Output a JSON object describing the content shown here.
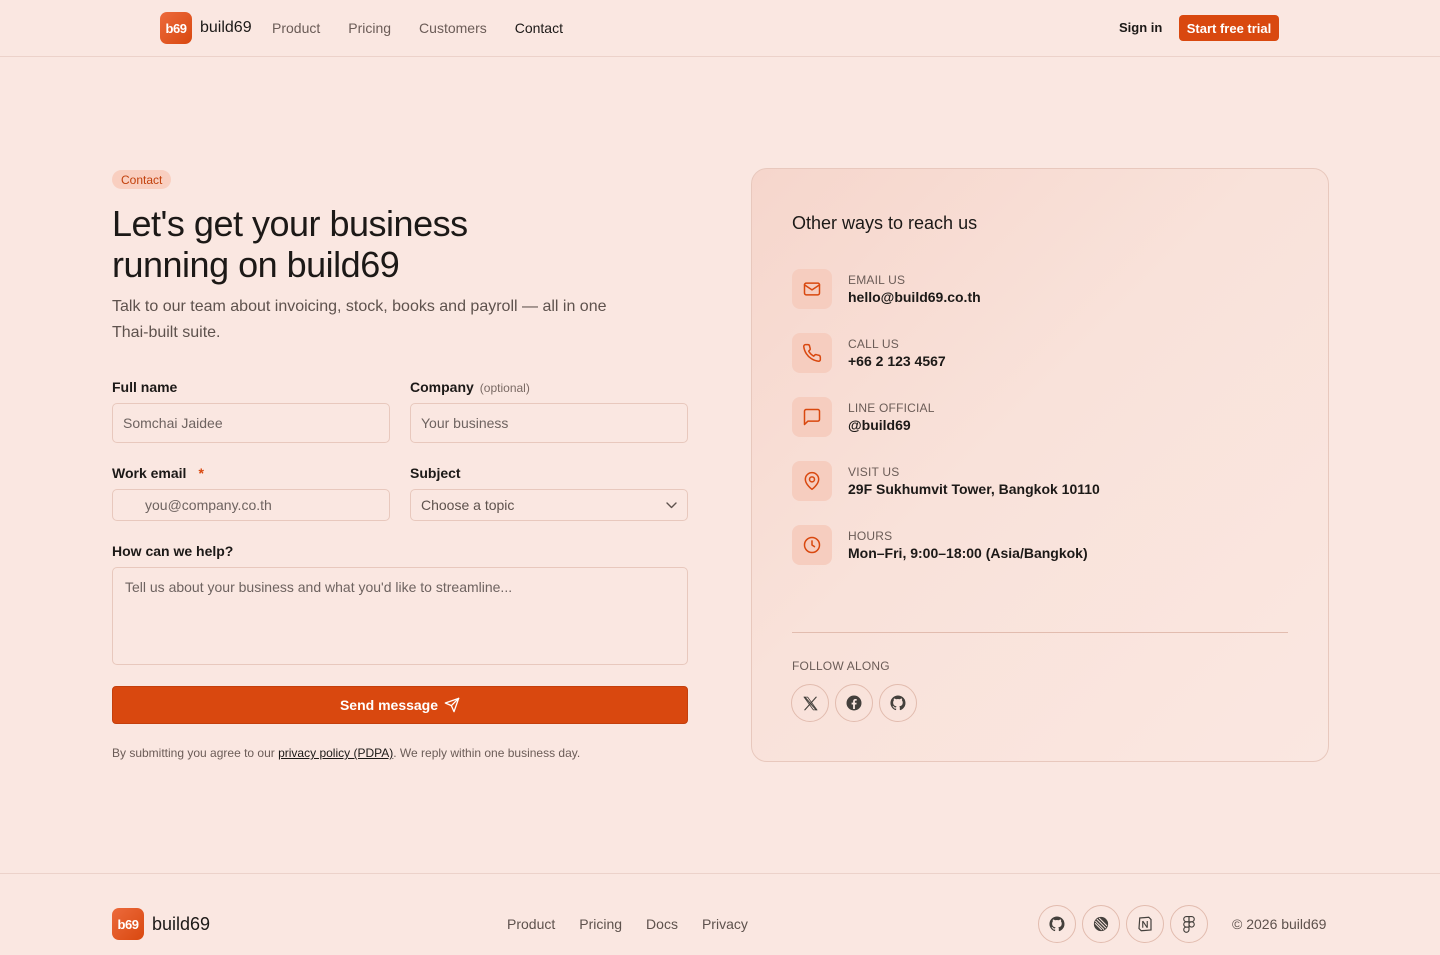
{
  "header": {
    "logo_text": "b69",
    "brand_name": "build69",
    "nav": [
      {
        "label": "Product"
      },
      {
        "label": "Pricing"
      },
      {
        "label": "Customers"
      },
      {
        "label": "Contact"
      }
    ],
    "sign_in": "Sign in",
    "cta": "Start free trial"
  },
  "intro": {
    "pill": "Contact",
    "title": "Let's get your business running on build69",
    "subtitle": "Talk to our team about invoicing, stock, books and payroll — all in one Thai-built suite."
  },
  "form": {
    "full_name": {
      "label": "Full name",
      "placeholder": "Somchai Jaidee"
    },
    "company": {
      "label": "Company",
      "optional": "(optional)",
      "placeholder": "Your business"
    },
    "email": {
      "label": "Work email",
      "required_mark": "*",
      "placeholder": "you@company.co.th"
    },
    "subject": {
      "label": "Subject",
      "value": "Choose a topic"
    },
    "message": {
      "label": "How can we help?",
      "placeholder": "Tell us about your business and what you'd like to streamline..."
    },
    "submit": "Send message",
    "disclaimer_before": "By submitting you agree to our ",
    "disclaimer_link": "privacy policy (PDPA)",
    "disclaimer_after": ". We reply within one business day."
  },
  "card": {
    "title": "Other ways to reach us",
    "items": [
      {
        "label": "EMAIL US",
        "value": "hello@build69.co.th",
        "icon": "mail-icon"
      },
      {
        "label": "CALL US",
        "value": "+66 2 123 4567",
        "icon": "phone-icon"
      },
      {
        "label": "LINE OFFICIAL",
        "value": "@build69",
        "icon": "chat-icon"
      },
      {
        "label": "VISIT US",
        "value": "29F Sukhumvit Tower, Bangkok 10110",
        "icon": "map-pin-icon"
      },
      {
        "label": "HOURS",
        "value": "Mon–Fri, 9:00–18:00 (Asia/Bangkok)",
        "icon": "clock-icon"
      }
    ],
    "follow_label": "FOLLOW ALONG"
  },
  "footer": {
    "logo_text": "b69",
    "brand_name": "build69",
    "nav": [
      {
        "label": "Product"
      },
      {
        "label": "Pricing"
      },
      {
        "label": "Docs"
      },
      {
        "label": "Privacy"
      }
    ],
    "copyright": "© 2026 build69"
  },
  "colors": {
    "accent": "#d9480f",
    "background": "#fae7e1",
    "icon_tile": "#f6cdbf"
  }
}
